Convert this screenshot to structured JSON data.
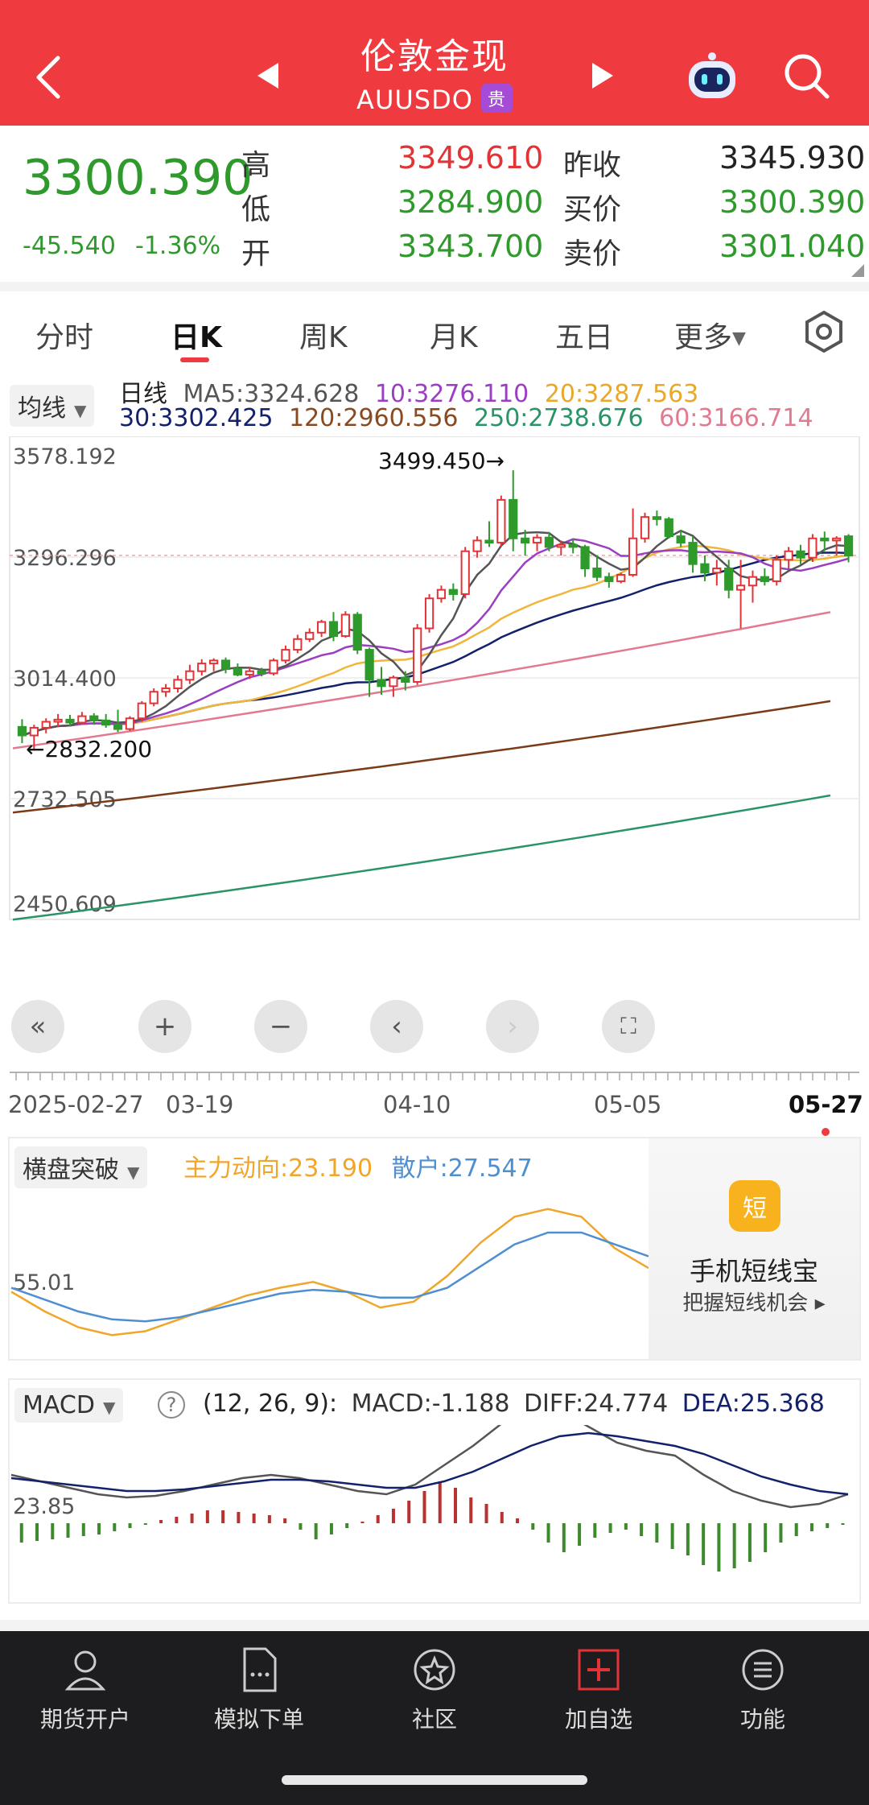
{
  "header": {
    "title": "伦敦金现",
    "symbol": "AUUSDO",
    "badge": "贵"
  },
  "quote": {
    "price": "3300.390",
    "change": "-45.540",
    "change_pct": "-1.36%",
    "high_label": "高",
    "high": "3349.610",
    "low_label": "低",
    "low": "3284.900",
    "open_label": "开",
    "open": "3343.700",
    "prev_close_label": "昨收",
    "prev_close": "3345.930",
    "bid_label": "买价",
    "bid": "3300.390",
    "ask_label": "卖价",
    "ask": "3301.040"
  },
  "tabs": [
    "分时",
    "日K",
    "周K",
    "月K",
    "五日",
    "更多"
  ],
  "ma_legend": {
    "selector": "均线",
    "label": "日线",
    "ma5": "MA5:3324.628",
    "ma10": "10:3276.110",
    "ma20": "20:3287.563",
    "ma30": "30:3302.425",
    "ma120": "120:2960.556",
    "ma250": "250:2738.676",
    "ma60": "60:3166.714"
  },
  "colors": {
    "up": "#e23437",
    "down": "#2f9a2c",
    "header": "#ef3b3f",
    "ma5": "#555555",
    "ma10": "#9b3fc2",
    "ma20": "#f0b63a",
    "ma30": "#13216b",
    "ma60": "#e27a8f",
    "ma120": "#7a3b17",
    "ma250": "#2a9468"
  },
  "chart_data": [
    {
      "type": "candlestick",
      "title": "",
      "y_ticks": [
        "3578.192",
        "3296.296",
        "3014.400",
        "2732.505",
        "2450.609"
      ],
      "ylim": [
        2450.609,
        3578.192
      ],
      "x_ticks": [
        "2025-02-27",
        "03-19",
        "04-10",
        "05-05",
        "05-27"
      ],
      "annotations": {
        "high": "3499.450→",
        "low": "←2832.200"
      },
      "reference_price": 3300.39,
      "candles_ohlc": [
        [
          2900,
          2918,
          2862,
          2880
        ],
        [
          2880,
          2905,
          2845,
          2898
        ],
        [
          2898,
          2920,
          2885,
          2912
        ],
        [
          2912,
          2930,
          2900,
          2917
        ],
        [
          2917,
          2928,
          2902,
          2910
        ],
        [
          2910,
          2935,
          2905,
          2925
        ],
        [
          2925,
          2932,
          2905,
          2915
        ],
        [
          2915,
          2930,
          2898,
          2905
        ],
        [
          2905,
          2940,
          2888,
          2895
        ],
        [
          2895,
          2925,
          2890,
          2920
        ],
        [
          2920,
          2960,
          2912,
          2955
        ],
        [
          2955,
          2990,
          2948,
          2982
        ],
        [
          2982,
          3000,
          2970,
          2990
        ],
        [
          2990,
          3020,
          2980,
          3010
        ],
        [
          3010,
          3045,
          3000,
          3030
        ],
        [
          3030,
          3058,
          3020,
          3048
        ],
        [
          3048,
          3060,
          3030,
          3055
        ],
        [
          3055,
          3062,
          3025,
          3035
        ],
        [
          3035,
          3048,
          3018,
          3022
        ],
        [
          3022,
          3040,
          3012,
          3030
        ],
        [
          3030,
          3038,
          3018,
          3025
        ],
        [
          3025,
          3060,
          3020,
          3055
        ],
        [
          3055,
          3090,
          3048,
          3080
        ],
        [
          3080,
          3115,
          3072,
          3105
        ],
        [
          3105,
          3130,
          3098,
          3120
        ],
        [
          3120,
          3150,
          3110,
          3145
        ],
        [
          3145,
          3168,
          3100,
          3112
        ],
        [
          3112,
          3170,
          3108,
          3162
        ],
        [
          3162,
          3168,
          3070,
          3080
        ],
        [
          3080,
          3085,
          2970,
          3010
        ],
        [
          3010,
          3040,
          2975,
          2995
        ],
        [
          2995,
          3020,
          2970,
          3015
        ],
        [
          3015,
          3030,
          2985,
          3005
        ],
        [
          3005,
          3140,
          2998,
          3130
        ],
        [
          3130,
          3210,
          3120,
          3200
        ],
        [
          3200,
          3230,
          3190,
          3220
        ],
        [
          3220,
          3235,
          3195,
          3210
        ],
        [
          3210,
          3320,
          3200,
          3310
        ],
        [
          3310,
          3345,
          3295,
          3335
        ],
        [
          3335,
          3380,
          3320,
          3330
        ],
        [
          3330,
          3440,
          3320,
          3430
        ],
        [
          3430,
          3499,
          3310,
          3340
        ],
        [
          3340,
          3360,
          3300,
          3330
        ],
        [
          3330,
          3350,
          3310,
          3342
        ],
        [
          3342,
          3355,
          3310,
          3320
        ],
        [
          3320,
          3335,
          3300,
          3325
        ],
        [
          3325,
          3340,
          3305,
          3320
        ],
        [
          3320,
          3325,
          3250,
          3270
        ],
        [
          3270,
          3300,
          3240,
          3250
        ],
        [
          3250,
          3260,
          3225,
          3240
        ],
        [
          3240,
          3260,
          3235,
          3255
        ],
        [
          3255,
          3410,
          3250,
          3340
        ],
        [
          3340,
          3400,
          3330,
          3390
        ],
        [
          3390,
          3405,
          3370,
          3385
        ],
        [
          3385,
          3390,
          3340,
          3345
        ],
        [
          3345,
          3360,
          3320,
          3330
        ],
        [
          3330,
          3345,
          3260,
          3280
        ],
        [
          3280,
          3300,
          3240,
          3260
        ],
        [
          3260,
          3290,
          3230,
          3270
        ],
        [
          3270,
          3290,
          3200,
          3220
        ],
        [
          3220,
          3290,
          3130,
          3230
        ],
        [
          3230,
          3265,
          3190,
          3250
        ],
        [
          3250,
          3270,
          3230,
          3240
        ],
        [
          3240,
          3300,
          3230,
          3290
        ],
        [
          3290,
          3320,
          3270,
          3310
        ],
        [
          3310,
          3325,
          3280,
          3295
        ],
        [
          3295,
          3350,
          3285,
          3340
        ],
        [
          3340,
          3356,
          3310,
          3335
        ],
        [
          3335,
          3345,
          3300,
          3340
        ],
        [
          3345,
          3350,
          3284,
          3300
        ]
      ],
      "ma_endpoints": {
        "ma60": [
          2850,
          3168
        ],
        "ma120": [
          2700,
          2960
        ],
        "ma250": [
          2450,
          2740
        ]
      }
    },
    {
      "type": "line",
      "indicator": "横盘突破",
      "series": [
        {
          "name": "主力动向:23.190",
          "values": [
            50,
            40,
            32,
            28,
            30,
            36,
            42,
            48,
            52,
            55,
            50,
            42,
            45,
            58,
            75,
            88,
            92,
            88,
            72,
            62
          ]
        },
        {
          "name": "散户:27.547",
          "values": [
            52,
            46,
            40,
            36,
            35,
            37,
            41,
            45,
            49,
            51,
            50,
            47,
            47,
            52,
            63,
            74,
            80,
            80,
            74,
            68
          ]
        }
      ],
      "y_tick": "55.01"
    },
    {
      "type": "macd",
      "indicator": "MACD",
      "params": "(12, 26, 9):",
      "macd_label": "MACD:-1.188",
      "diff_label": "DIFF:24.774",
      "dea_label": "DEA:25.368",
      "y_tick": "23.85",
      "diff": [
        30,
        26,
        22,
        18,
        16,
        17,
        20,
        24,
        28,
        30,
        28,
        24,
        20,
        18,
        24,
        36,
        48,
        62,
        72,
        70,
        60,
        50,
        45,
        42,
        30,
        20,
        14,
        10,
        12,
        18
      ],
      "dea": [
        28,
        26,
        24,
        22,
        20,
        20,
        21,
        23,
        25,
        27,
        27,
        26,
        24,
        22,
        22,
        26,
        32,
        40,
        48,
        54,
        56,
        54,
        51,
        48,
        43,
        36,
        29,
        24,
        20,
        18
      ],
      "hist": [
        -12,
        -11,
        -10,
        -9,
        -8,
        -7,
        -5,
        -3,
        -1,
        2,
        4,
        6,
        8,
        8,
        7,
        6,
        5,
        3,
        -4,
        -10,
        -7,
        -3,
        1,
        5,
        9,
        14,
        20,
        26,
        22,
        16,
        12,
        7,
        3,
        -4,
        -12,
        -18,
        -14,
        -9,
        -6,
        -4,
        -8,
        -12,
        -16,
        -20,
        -26,
        -30,
        -28,
        -24,
        -18,
        -12,
        -8,
        -5,
        -3,
        -1
      ]
    }
  ],
  "short_line_promo": {
    "icon": "短",
    "title": "手机短线宝",
    "subtitle": "把握短线机会 ▸"
  },
  "bottom_nav": [
    {
      "label": "期货开户",
      "icon": "person-icon"
    },
    {
      "label": "模拟下单",
      "icon": "document-icon"
    },
    {
      "label": "社区",
      "icon": "star-icon"
    },
    {
      "label": "加自选",
      "icon": "plus-icon"
    },
    {
      "label": "功能",
      "icon": "menu-icon"
    }
  ]
}
